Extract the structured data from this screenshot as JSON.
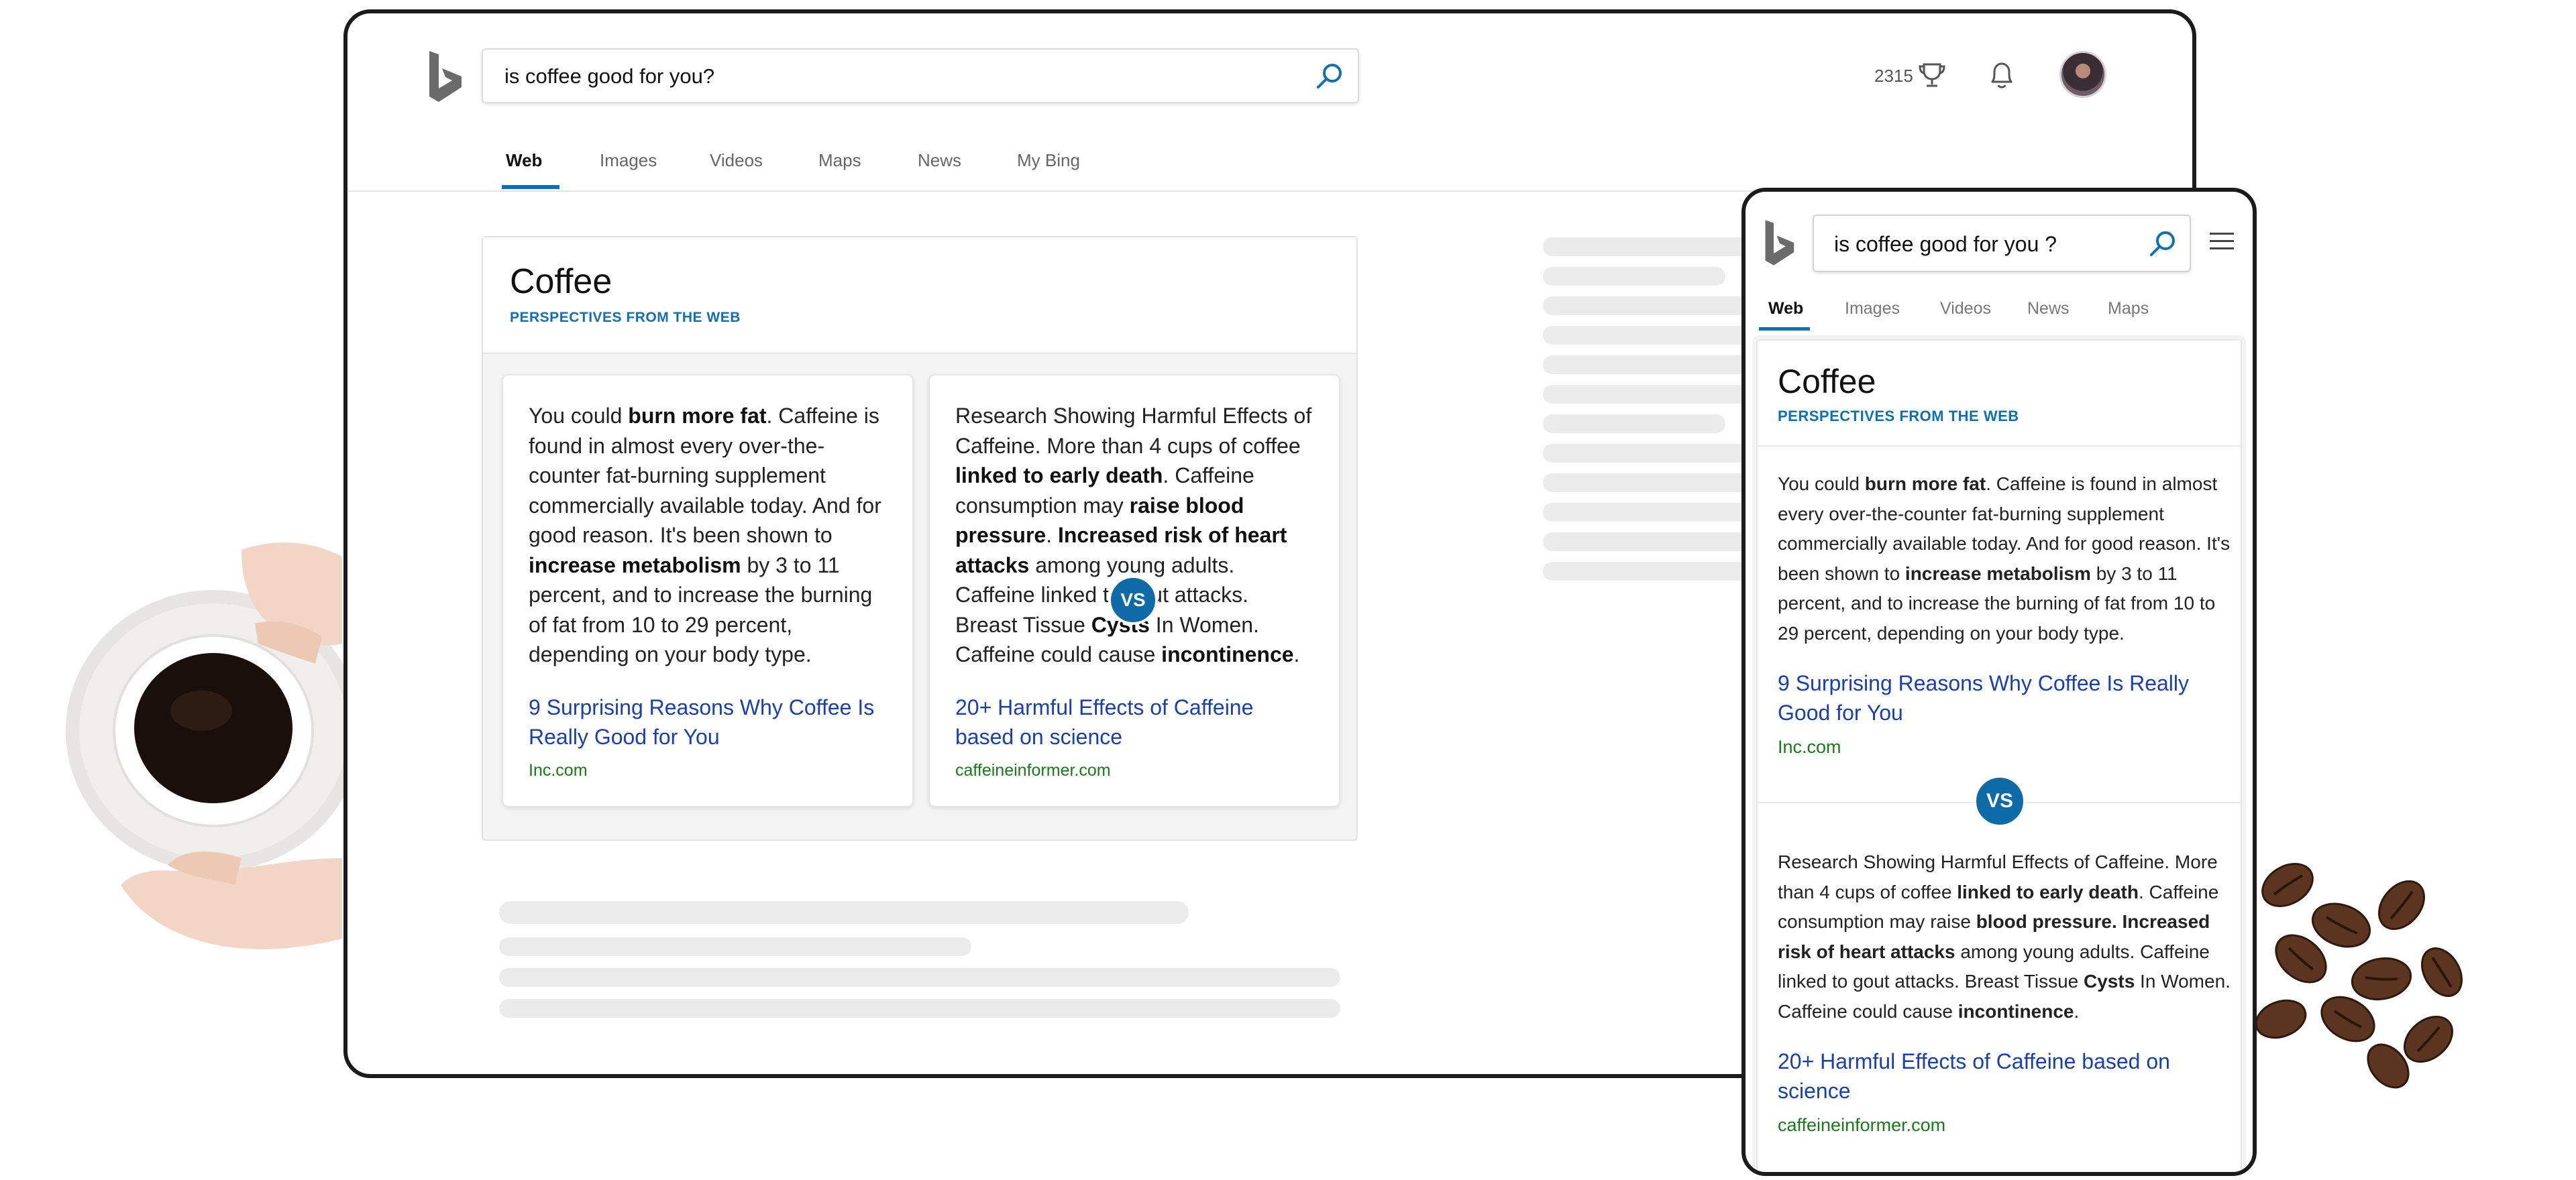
{
  "desktop": {
    "search": {
      "query": "is coffee good for you?"
    },
    "header": {
      "rewards_points": "2315"
    },
    "tabs": [
      "Web",
      "Images",
      "Videos",
      "Maps",
      "News",
      "My Bing"
    ],
    "card": {
      "title": "Coffee",
      "subtitle": "PERSPECTIVES FROM THE WEB",
      "vs_label": "VS",
      "left": {
        "link": "9 Surprising Reasons Why Coffee Is Really Good for You",
        "domain": "Inc.com"
      },
      "right": {
        "link": "20+ Harmful Effects of Caffeine based on science",
        "domain": "caffeineinformer.com"
      }
    }
  },
  "mobile": {
    "search": {
      "query": "is coffee good for you ?"
    },
    "tabs": [
      "Web",
      "Images",
      "Videos",
      "News",
      "Maps"
    ],
    "card": {
      "title": "Coffee",
      "subtitle": "PERSPECTIVES FROM THE WEB",
      "vs_label": "VS",
      "top": {
        "link": "9 Surprising Reasons Why Coffee Is Really Good for You",
        "domain": "Inc.com"
      },
      "bottom": {
        "link": "20+ Harmful Effects of Caffeine based on science",
        "domain": "caffeineinformer.com"
      }
    }
  },
  "perspectives": {
    "pro": [
      {
        "t": "You could "
      },
      {
        "b": "burn more fat"
      },
      {
        "t": ". Caffeine is found in almost every over-the-counter fat-burning supplement commercially available today. And for good reason. It's been shown to "
      },
      {
        "b": "increase metabolism"
      },
      {
        "t": " by 3 to 11 percent, and to increase the burning of fat from 10 to 29 percent, depending on your body type."
      }
    ],
    "con_desktop": [
      {
        "t": "Research Showing Harmful Effects of Caffeine. More than 4 cups of coffee "
      },
      {
        "b": "linked to early death"
      },
      {
        "t": ". Caffeine consumption may "
      },
      {
        "b": "raise blood pressure"
      },
      {
        "t": ". "
      },
      {
        "b": "Increased risk of heart attacks"
      },
      {
        "t": " among young adults. Caffeine linked to gout attacks. Breast Tissue "
      },
      {
        "b": "Cysts"
      },
      {
        "t": " In Women. Caffeine could cause "
      },
      {
        "b": "incontinence"
      },
      {
        "t": "."
      }
    ],
    "con_mobile": [
      {
        "t": "Research Showing Harmful Effects of Caffeine. More than 4 cups of coffee "
      },
      {
        "b": "linked to early death"
      },
      {
        "t": ". Caffeine consumption may raise "
      },
      {
        "b": "blood pressure. Increased risk of heart attacks"
      },
      {
        "t": " among young adults. Caffeine linked to gout attacks. Breast Tissue "
      },
      {
        "b": "Cysts"
      },
      {
        "t": " In Women. Caffeine could cause "
      },
      {
        "b": "incontinence"
      },
      {
        "t": "."
      }
    ]
  },
  "colors": {
    "accent": "#1170b4",
    "link": "#1a3fb0",
    "domain": "#1a7a1a",
    "vs_badge": "#0e6ba8",
    "skeleton": "#ebebeb"
  },
  "icons": [
    "bing-logo-icon",
    "search-icon",
    "trophy-icon",
    "bell-icon",
    "menu-icon",
    "avatar"
  ]
}
